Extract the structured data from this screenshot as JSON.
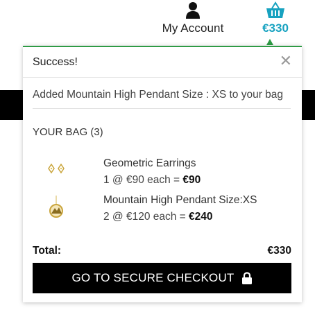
{
  "header": {
    "account_label": "My Account",
    "account_icon": "user-icon",
    "basket_icon": "basket-icon",
    "basket_total": "€330",
    "accent_color": "#17a2c0"
  },
  "popup": {
    "title": "Success!",
    "close_icon": "close-icon",
    "message": "Added Mountain High Pendant Size : XS to your bag",
    "bag_heading": "YOUR BAG (3)",
    "border_color": "#2e9b45",
    "items": [
      {
        "name": "Geometric Earrings",
        "price_prefix": "1 @ €90 each = ",
        "price_total": "€90",
        "thumb_icon": "earrings-thumbnail"
      },
      {
        "name": "Mountain High Pendant Size:XS",
        "price_prefix": "2 @ €120 each = ",
        "price_total": "€240",
        "thumb_icon": "pendant-thumbnail"
      }
    ],
    "total_label": "Total:",
    "total_amount": "€330",
    "checkout_label": "GO TO SECURE CHECKOUT",
    "checkout_icon": "lock-icon"
  }
}
